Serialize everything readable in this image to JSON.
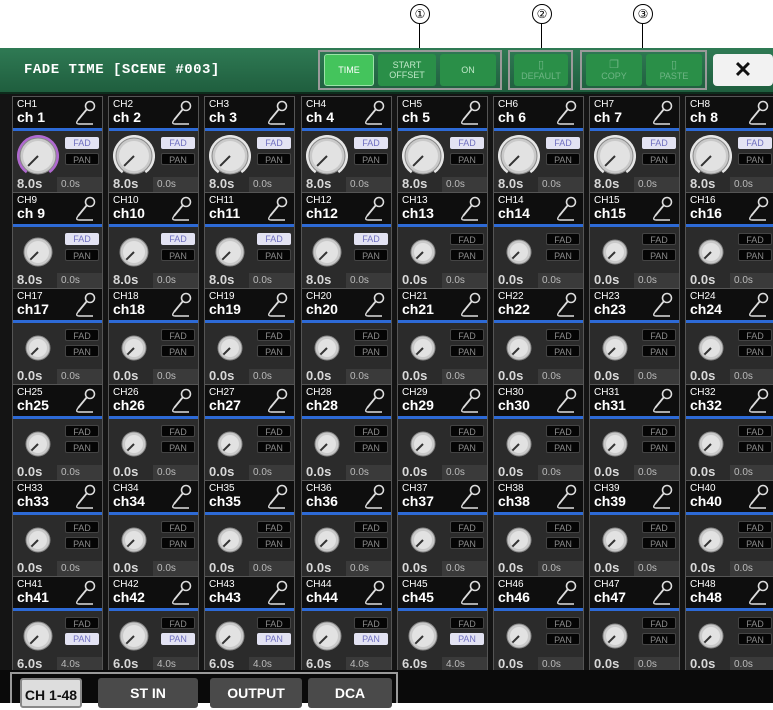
{
  "callouts": [
    "①",
    "②",
    "③"
  ],
  "title": "FADE TIME [SCENE #003]",
  "toolbar": {
    "time_label": "TIME",
    "start_offset_label": "START\nOFFSET",
    "on_label": "ON",
    "default_label": "DEFAULT",
    "copy_label": "COPY",
    "paste_label": "PASTE",
    "close_label": "✕"
  },
  "tag_labels": {
    "fad": "FAD",
    "pan": "PAN"
  },
  "colors": {
    "title_bar": "#2f7a54",
    "tab_active": "#3fbf5a",
    "accent_knob": "#b069d0",
    "channel_bar": "#2d6ad6"
  },
  "channels": [
    {
      "id": "CH1",
      "name": "ch 1",
      "fade": "8.0s",
      "offset": "0.0s",
      "fad": true,
      "pan": false,
      "knob": "large",
      "selected": true
    },
    {
      "id": "CH2",
      "name": "ch 2",
      "fade": "8.0s",
      "offset": "0.0s",
      "fad": true,
      "pan": false,
      "knob": "large"
    },
    {
      "id": "CH3",
      "name": "ch 3",
      "fade": "8.0s",
      "offset": "0.0s",
      "fad": true,
      "pan": false,
      "knob": "large"
    },
    {
      "id": "CH4",
      "name": "ch 4",
      "fade": "8.0s",
      "offset": "0.0s",
      "fad": true,
      "pan": false,
      "knob": "large"
    },
    {
      "id": "CH5",
      "name": "ch 5",
      "fade": "8.0s",
      "offset": "0.0s",
      "fad": true,
      "pan": false,
      "knob": "large"
    },
    {
      "id": "CH6",
      "name": "ch 6",
      "fade": "8.0s",
      "offset": "0.0s",
      "fad": true,
      "pan": false,
      "knob": "large"
    },
    {
      "id": "CH7",
      "name": "ch 7",
      "fade": "8.0s",
      "offset": "0.0s",
      "fad": true,
      "pan": false,
      "knob": "large"
    },
    {
      "id": "CH8",
      "name": "ch 8",
      "fade": "8.0s",
      "offset": "0.0s",
      "fad": true,
      "pan": false,
      "knob": "large"
    },
    {
      "id": "CH9",
      "name": "ch 9",
      "fade": "8.0s",
      "offset": "0.0s",
      "fad": true,
      "pan": false,
      "knob": "medium"
    },
    {
      "id": "CH10",
      "name": "ch10",
      "fade": "8.0s",
      "offset": "0.0s",
      "fad": true,
      "pan": false,
      "knob": "medium"
    },
    {
      "id": "CH11",
      "name": "ch11",
      "fade": "8.0s",
      "offset": "0.0s",
      "fad": true,
      "pan": false,
      "knob": "medium"
    },
    {
      "id": "CH12",
      "name": "ch12",
      "fade": "8.0s",
      "offset": "0.0s",
      "fad": true,
      "pan": false,
      "knob": "medium"
    },
    {
      "id": "CH13",
      "name": "ch13",
      "fade": "0.0s",
      "offset": "0.0s",
      "fad": false,
      "pan": false,
      "knob": "small"
    },
    {
      "id": "CH14",
      "name": "ch14",
      "fade": "0.0s",
      "offset": "0.0s",
      "fad": false,
      "pan": false,
      "knob": "small"
    },
    {
      "id": "CH15",
      "name": "ch15",
      "fade": "0.0s",
      "offset": "0.0s",
      "fad": false,
      "pan": false,
      "knob": "small"
    },
    {
      "id": "CH16",
      "name": "ch16",
      "fade": "0.0s",
      "offset": "0.0s",
      "fad": false,
      "pan": false,
      "knob": "small"
    },
    {
      "id": "CH17",
      "name": "ch17",
      "fade": "0.0s",
      "offset": "0.0s",
      "fad": false,
      "pan": false,
      "knob": "small"
    },
    {
      "id": "CH18",
      "name": "ch18",
      "fade": "0.0s",
      "offset": "0.0s",
      "fad": false,
      "pan": false,
      "knob": "small"
    },
    {
      "id": "CH19",
      "name": "ch19",
      "fade": "0.0s",
      "offset": "0.0s",
      "fad": false,
      "pan": false,
      "knob": "small"
    },
    {
      "id": "CH20",
      "name": "ch20",
      "fade": "0.0s",
      "offset": "0.0s",
      "fad": false,
      "pan": false,
      "knob": "small"
    },
    {
      "id": "CH21",
      "name": "ch21",
      "fade": "0.0s",
      "offset": "0.0s",
      "fad": false,
      "pan": false,
      "knob": "small"
    },
    {
      "id": "CH22",
      "name": "ch22",
      "fade": "0.0s",
      "offset": "0.0s",
      "fad": false,
      "pan": false,
      "knob": "small"
    },
    {
      "id": "CH23",
      "name": "ch23",
      "fade": "0.0s",
      "offset": "0.0s",
      "fad": false,
      "pan": false,
      "knob": "small"
    },
    {
      "id": "CH24",
      "name": "ch24",
      "fade": "0.0s",
      "offset": "0.0s",
      "fad": false,
      "pan": false,
      "knob": "small"
    },
    {
      "id": "CH25",
      "name": "ch25",
      "fade": "0.0s",
      "offset": "0.0s",
      "fad": false,
      "pan": false,
      "knob": "small"
    },
    {
      "id": "CH26",
      "name": "ch26",
      "fade": "0.0s",
      "offset": "0.0s",
      "fad": false,
      "pan": false,
      "knob": "small"
    },
    {
      "id": "CH27",
      "name": "ch27",
      "fade": "0.0s",
      "offset": "0.0s",
      "fad": false,
      "pan": false,
      "knob": "small"
    },
    {
      "id": "CH28",
      "name": "ch28",
      "fade": "0.0s",
      "offset": "0.0s",
      "fad": false,
      "pan": false,
      "knob": "small"
    },
    {
      "id": "CH29",
      "name": "ch29",
      "fade": "0.0s",
      "offset": "0.0s",
      "fad": false,
      "pan": false,
      "knob": "small"
    },
    {
      "id": "CH30",
      "name": "ch30",
      "fade": "0.0s",
      "offset": "0.0s",
      "fad": false,
      "pan": false,
      "knob": "small"
    },
    {
      "id": "CH31",
      "name": "ch31",
      "fade": "0.0s",
      "offset": "0.0s",
      "fad": false,
      "pan": false,
      "knob": "small"
    },
    {
      "id": "CH32",
      "name": "ch32",
      "fade": "0.0s",
      "offset": "0.0s",
      "fad": false,
      "pan": false,
      "knob": "small"
    },
    {
      "id": "CH33",
      "name": "ch33",
      "fade": "0.0s",
      "offset": "0.0s",
      "fad": false,
      "pan": false,
      "knob": "small"
    },
    {
      "id": "CH34",
      "name": "ch34",
      "fade": "0.0s",
      "offset": "0.0s",
      "fad": false,
      "pan": false,
      "knob": "small"
    },
    {
      "id": "CH35",
      "name": "ch35",
      "fade": "0.0s",
      "offset": "0.0s",
      "fad": false,
      "pan": false,
      "knob": "small"
    },
    {
      "id": "CH36",
      "name": "ch36",
      "fade": "0.0s",
      "offset": "0.0s",
      "fad": false,
      "pan": false,
      "knob": "small"
    },
    {
      "id": "CH37",
      "name": "ch37",
      "fade": "0.0s",
      "offset": "0.0s",
      "fad": false,
      "pan": false,
      "knob": "small"
    },
    {
      "id": "CH38",
      "name": "ch38",
      "fade": "0.0s",
      "offset": "0.0s",
      "fad": false,
      "pan": false,
      "knob": "small"
    },
    {
      "id": "CH39",
      "name": "ch39",
      "fade": "0.0s",
      "offset": "0.0s",
      "fad": false,
      "pan": false,
      "knob": "small"
    },
    {
      "id": "CH40",
      "name": "ch40",
      "fade": "0.0s",
      "offset": "0.0s",
      "fad": false,
      "pan": false,
      "knob": "small"
    },
    {
      "id": "CH41",
      "name": "ch41",
      "fade": "6.0s",
      "offset": "4.0s",
      "fad": false,
      "pan": true,
      "knob": "medium"
    },
    {
      "id": "CH42",
      "name": "ch42",
      "fade": "6.0s",
      "offset": "4.0s",
      "fad": false,
      "pan": true,
      "knob": "medium"
    },
    {
      "id": "CH43",
      "name": "ch43",
      "fade": "6.0s",
      "offset": "4.0s",
      "fad": false,
      "pan": true,
      "knob": "medium"
    },
    {
      "id": "CH44",
      "name": "ch44",
      "fade": "6.0s",
      "offset": "4.0s",
      "fad": false,
      "pan": true,
      "knob": "medium"
    },
    {
      "id": "CH45",
      "name": "ch45",
      "fade": "6.0s",
      "offset": "4.0s",
      "fad": false,
      "pan": true,
      "knob": "medium"
    },
    {
      "id": "CH46",
      "name": "ch46",
      "fade": "0.0s",
      "offset": "0.0s",
      "fad": false,
      "pan": false,
      "knob": "small"
    },
    {
      "id": "CH47",
      "name": "ch47",
      "fade": "0.0s",
      "offset": "0.0s",
      "fad": false,
      "pan": false,
      "knob": "small"
    },
    {
      "id": "CH48",
      "name": "ch48",
      "fade": "0.0s",
      "offset": "0.0s",
      "fad": false,
      "pan": false,
      "knob": "small"
    }
  ],
  "bottom_tabs": [
    {
      "label": "CH 1-48",
      "selected": true
    },
    {
      "label": "ST IN",
      "selected": false
    },
    {
      "label": "OUTPUT",
      "selected": false
    },
    {
      "label": "DCA",
      "selected": false
    }
  ]
}
